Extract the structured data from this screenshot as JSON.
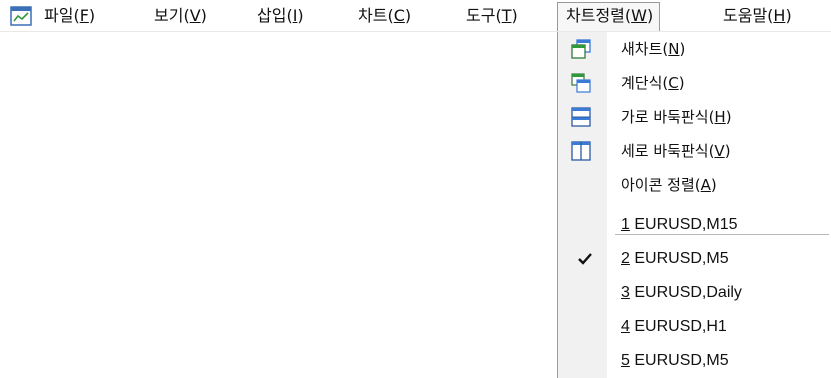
{
  "menubar": {
    "icon": "chart-window-icon",
    "items": [
      {
        "label": "파일(",
        "key": "F",
        "close": ")"
      },
      {
        "label": "보기(",
        "key": "V",
        "close": ")"
      },
      {
        "label": "삽입(",
        "key": "I",
        "close": ")"
      },
      {
        "label": "차트(",
        "key": "C",
        "close": ")"
      },
      {
        "label": "도구(",
        "key": "T",
        "close": ")"
      },
      {
        "label": "차트정렬(",
        "key": "W",
        "close": ")"
      },
      {
        "label": "도움말(",
        "key": "H",
        "close": ")"
      }
    ]
  },
  "window_menu": {
    "commands": [
      {
        "label": "새차트(",
        "key": "N",
        "close": ")",
        "icon": "new-window-icon"
      },
      {
        "label": "계단식(",
        "key": "C",
        "close": ")",
        "icon": "cascade-icon"
      },
      {
        "label": "가로 바둑판식(",
        "key": "H",
        "close": ")",
        "icon": "tile-horizontal-icon"
      },
      {
        "label": "세로 바둑판식(",
        "key": "V",
        "close": ")",
        "icon": "tile-vertical-icon"
      },
      {
        "label": "아이콘 정렬(",
        "key": "A",
        "close": ")",
        "icon": ""
      }
    ],
    "windows": [
      {
        "num": "1",
        "label": " EURUSD,M15",
        "checked": false
      },
      {
        "num": "2",
        "label": " EURUSD,M5",
        "checked": true
      },
      {
        "num": "3",
        "label": " EURUSD,Daily",
        "checked": false
      },
      {
        "num": "4",
        "label": " EURUSD,H1",
        "checked": false
      },
      {
        "num": "5",
        "label": " EURUSD,M5",
        "checked": false
      }
    ]
  },
  "colors": {
    "menu_bg": "#ffffff",
    "gutter_bg": "#f1f1f1",
    "icon_blue": "#3a7bd5",
    "icon_green": "#2e9a3a"
  }
}
